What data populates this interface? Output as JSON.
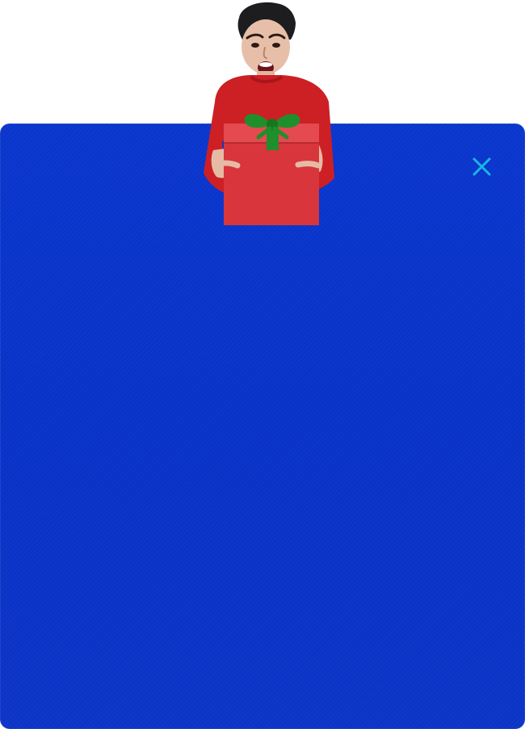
{
  "dialog": {
    "panel_color": "#0a36cf",
    "close_icon": "close-icon",
    "close_icon_color": "#19b6e8"
  },
  "promo_image": {
    "subject": "man-holding-gift-box",
    "sweater_color": "#cc2025",
    "gift_box_color": "#d8353c",
    "ribbon_color": "#1f8f2c"
  }
}
